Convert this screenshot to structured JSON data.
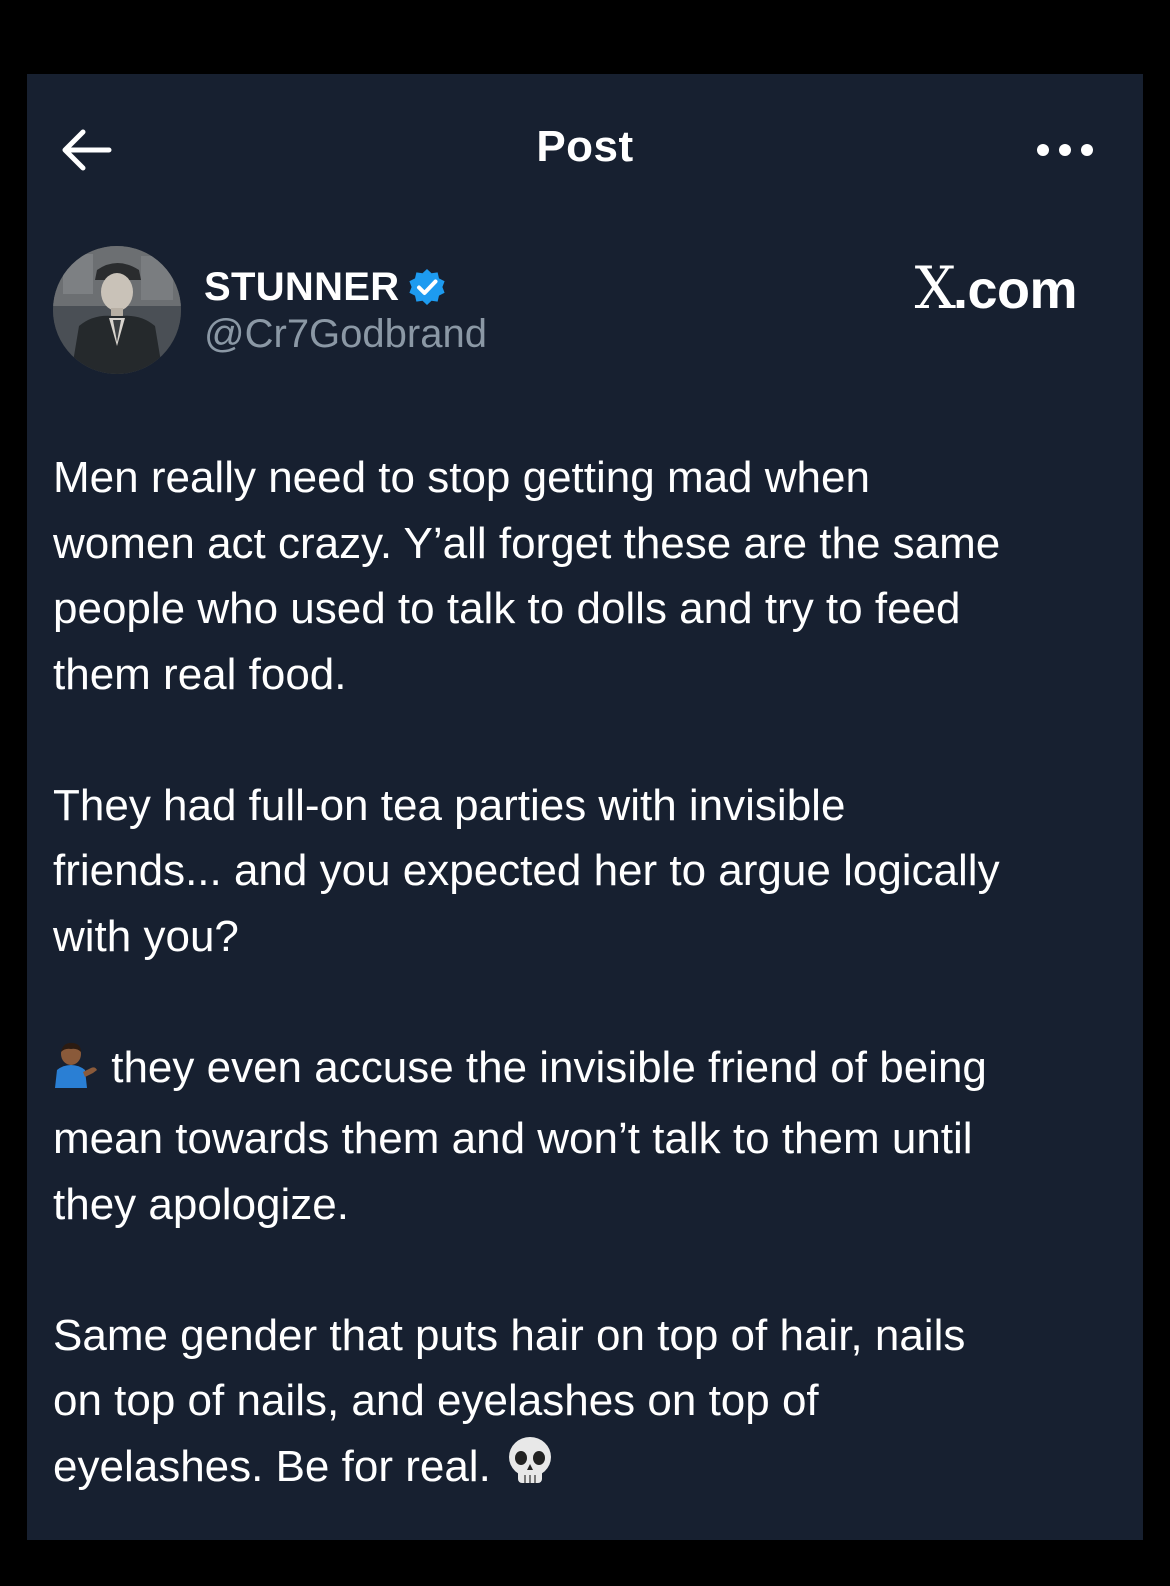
{
  "header": {
    "title": "Post",
    "back_icon": "arrow-left-icon",
    "more_icon": "more-horizontal-icon"
  },
  "author": {
    "display_name": "STUNNER",
    "handle": "@Cr7Godbrand",
    "verified": true,
    "verified_color": "#1d9bf0"
  },
  "brand": {
    "x": "X",
    "suffix": ".com"
  },
  "post": {
    "paragraphs": [
      {
        "text": "Men really need to stop getting mad when\nwomen act crazy. Y’all forget these are the same\npeople who used to talk to dolls and try to feed\nthem real food."
      },
      {
        "text": "They had full-on tea parties with invisible\nfriends... and you expected her to argue logically\nwith you?"
      },
      {
        "lead_emoji": "person-tipping-hand-emoji",
        "text": " they even accuse the invisible friend of being\nmean towards them and won’t talk to them until\nthey apologize."
      },
      {
        "text": "Same gender that puts hair on top of hair, nails\non top of nails, and eyelashes on top of\neyelashes. Be for real.",
        "trail_emoji": "skull-emoji"
      }
    ]
  },
  "colors": {
    "background": "#000000",
    "card": "#172030",
    "text": "#ffffff",
    "secondary_text": "#8b98a5"
  }
}
